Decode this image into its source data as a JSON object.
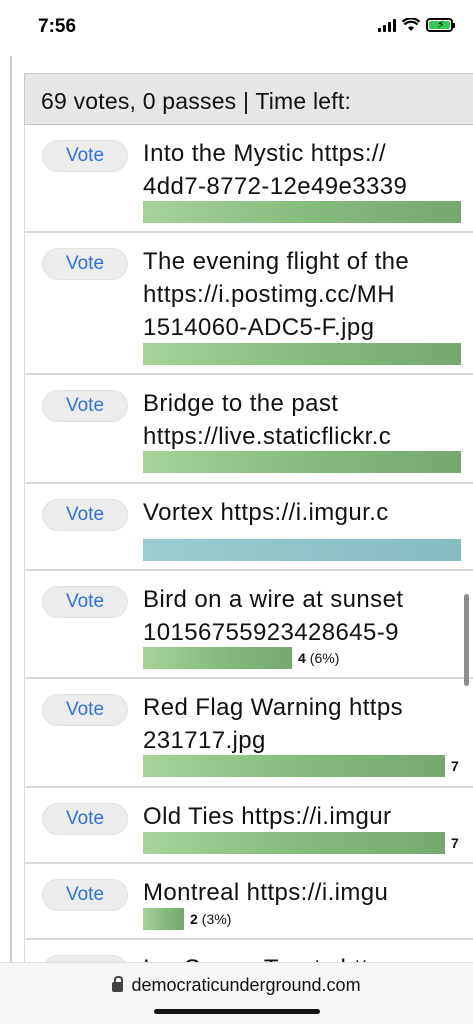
{
  "status_bar": {
    "time": "7:56"
  },
  "poll": {
    "header": "69 votes, 0 passes | Time left:",
    "vote_label": "Vote",
    "entries": [
      {
        "line1": "Into the Mystic https://",
        "line2": "4dd7-8772-12e49e3339",
        "bar_fraction": 1.0,
        "votes": "",
        "percent": "",
        "bar_color": "green"
      },
      {
        "line1": "The evening flight of the",
        "line2": "https://i.postimg.cc/MH",
        "line3": "1514060-ADC5-F.jpg",
        "bar_fraction": 1.0,
        "votes": "",
        "percent": "",
        "bar_color": "green"
      },
      {
        "line1": "Bridge to the past",
        "line2": "https://live.staticflickr.c",
        "bar_fraction": 1.0,
        "votes": "",
        "percent": "",
        "bar_color": "green"
      },
      {
        "line1": "Vortex https://i.imgur.c",
        "bar_fraction": 1.0,
        "votes": "",
        "percent": "",
        "bar_color": "teal"
      },
      {
        "line1": "Bird on a wire at sunset",
        "line2": "10156755923428645-9",
        "bar_fraction": 0.47,
        "votes": "4",
        "percent": "(6%)",
        "bar_color": "green"
      },
      {
        "line1": "Red Flag Warning https",
        "line2": "231717.jpg",
        "bar_fraction": 0.95,
        "votes": "7",
        "percent": "",
        "bar_color": "green"
      },
      {
        "line1": "Old Ties https://i.imgur",
        "bar_fraction": 0.95,
        "votes": "7",
        "percent": "",
        "bar_color": "green"
      },
      {
        "line1": "Montreal https://i.imgu",
        "bar_fraction": 0.13,
        "votes": "2",
        "percent": "(3%)",
        "bar_color": "green"
      },
      {
        "line1": "Ice Cream Treats https:",
        "bar_fraction": 0,
        "votes": "",
        "percent": "",
        "bar_color": "green"
      }
    ]
  },
  "browser": {
    "url": "democraticunderground.com"
  },
  "colors": {
    "vote_text": "#2f73d6",
    "bar_green": "#86bc7e",
    "bar_teal": "#85bcc0",
    "battery": "#34c759"
  }
}
